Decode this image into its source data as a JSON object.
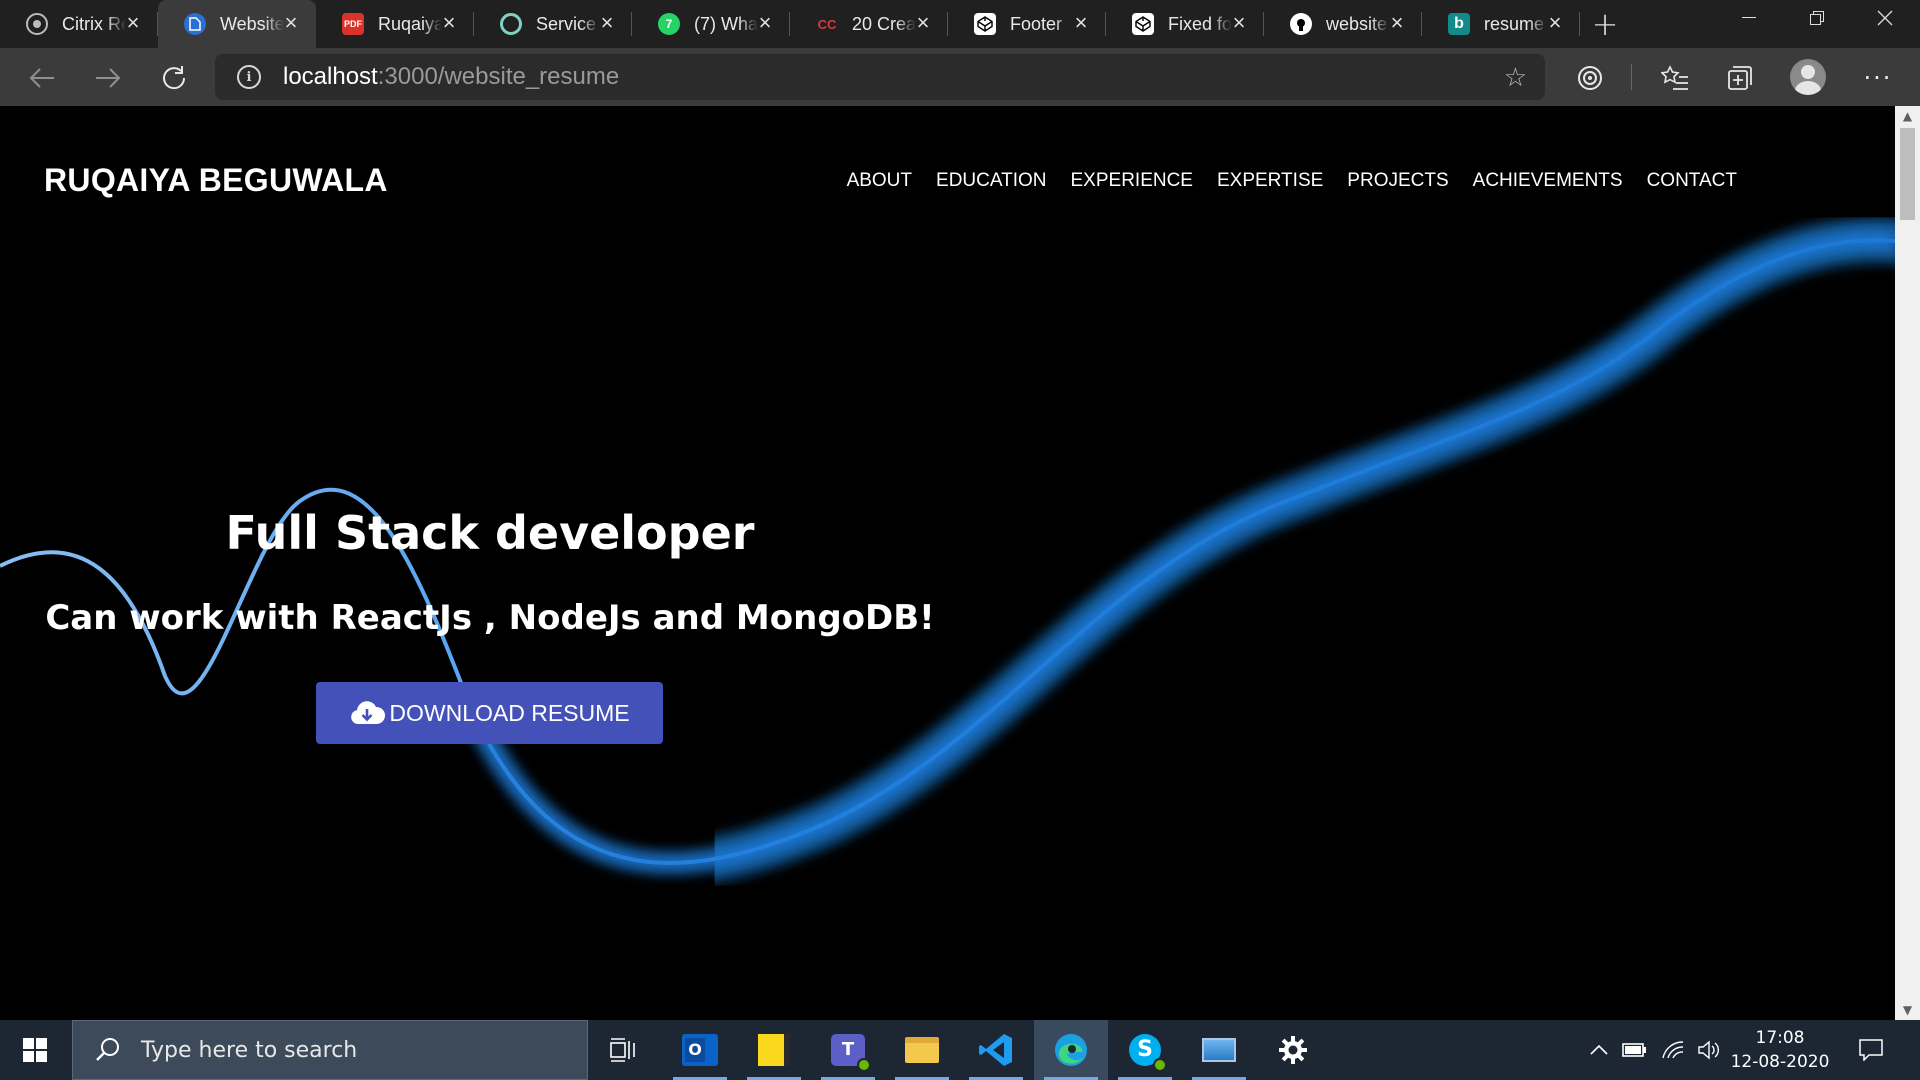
{
  "browser": {
    "tabs": [
      {
        "title": "Citrix Re",
        "icon": "citrix-icon",
        "active": false
      },
      {
        "title": "Website",
        "icon": "document-icon",
        "active": true
      },
      {
        "title": "Ruqaiya",
        "icon": "pdf-icon",
        "active": false
      },
      {
        "title": "Service",
        "icon": "service-icon",
        "active": false
      },
      {
        "title": "(7) Wha",
        "icon": "whatsapp-icon",
        "active": false
      },
      {
        "title": "20 Crea",
        "icon": "cc-icon",
        "active": false
      },
      {
        "title": "Footer",
        "icon": "codepen-icon",
        "active": false
      },
      {
        "title": "Fixed fo",
        "icon": "codepen-icon",
        "active": false
      },
      {
        "title": "website",
        "icon": "github-icon",
        "active": false
      },
      {
        "title": "resume",
        "icon": "bing-icon",
        "active": false
      }
    ],
    "pdf_badge": "PDF",
    "cc_badge": "CC",
    "bing_badge": "b",
    "url_host": "localhost",
    "url_path": ":3000/website_resume"
  },
  "site": {
    "brand": "RUQAIYA BEGUWALA",
    "nav": [
      "ABOUT",
      "EDUCATION",
      "EXPERIENCE",
      "EXPERTISE",
      "PROJECTS",
      "ACHIEVEMENTS",
      "CONTACT"
    ],
    "hero_title": "Full Stack developer",
    "hero_subtitle": "Can work with ReactJs , NodeJs and MongoDB!",
    "download_label": "DOWNLOAD RESUME",
    "colors": {
      "button": "#4351b8",
      "wave": "#1e88e5",
      "background": "#000000"
    }
  },
  "taskbar": {
    "search_placeholder": "Type here to search",
    "apps": [
      "task-view-icon",
      "outlook-icon",
      "sticky-notes-icon",
      "teams-icon",
      "file-explorer-icon",
      "vscode-icon",
      "edge-icon",
      "skype-icon",
      "desktop-icon",
      "settings-icon"
    ],
    "outlook_badge": "O",
    "teams_badge": "T",
    "time": "17:08",
    "date": "12-08-2020"
  }
}
